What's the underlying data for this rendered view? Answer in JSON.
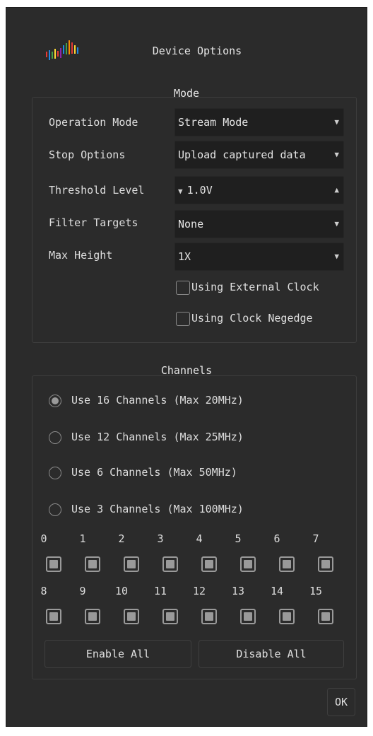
{
  "window": {
    "title": "Device Options"
  },
  "mode": {
    "group_title": "Mode",
    "operation_mode": {
      "label": "Operation Mode",
      "value": "Stream Mode"
    },
    "stop_options": {
      "label": "Stop Options",
      "value": "Upload captured data"
    },
    "threshold_level": {
      "label": "Threshold Level",
      "value": "1.0V"
    },
    "filter_targets": {
      "label": "Filter Targets",
      "value": "None"
    },
    "max_height": {
      "label": "Max Height",
      "value": "1X"
    },
    "external_clock": {
      "label": "Using External Clock",
      "checked": false
    },
    "clock_negedge": {
      "label": "Using Clock Negedge",
      "checked": false
    }
  },
  "channels": {
    "group_title": "Channels",
    "options": [
      {
        "label": "Use 16 Channels (Max 20MHz)",
        "selected": true
      },
      {
        "label": "Use 12 Channels (Max 25MHz)",
        "selected": false
      },
      {
        "label": "Use 6 Channels (Max 50MHz)",
        "selected": false
      },
      {
        "label": "Use 3 Channels (Max 100MHz)",
        "selected": false
      }
    ],
    "row1": [
      "0",
      "1",
      "2",
      "3",
      "4",
      "5",
      "6",
      "7"
    ],
    "row2": [
      "8",
      "9",
      "10",
      "11",
      "12",
      "13",
      "14",
      "15"
    ],
    "enable_all_label": "Enable All",
    "disable_all_label": "Disable All"
  },
  "ok_label": "OK"
}
